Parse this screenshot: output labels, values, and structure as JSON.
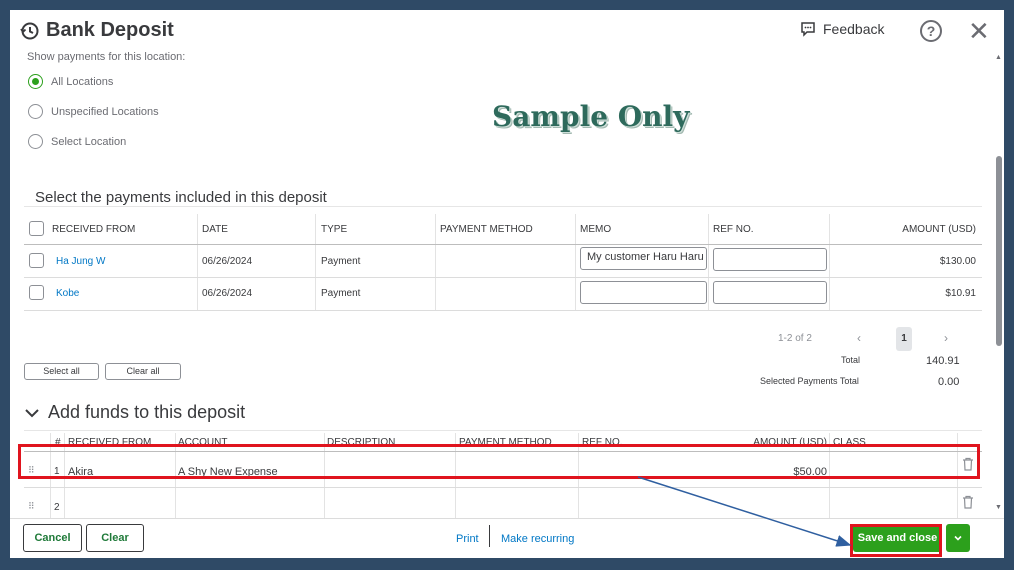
{
  "header": {
    "title": "Bank Deposit",
    "feedback_label": "Feedback",
    "help_label": "?",
    "close_label": "✕"
  },
  "location": {
    "label": "Show payments for this location:",
    "options": [
      {
        "label": "All Locations",
        "selected": true
      },
      {
        "label": "Unspecified Locations",
        "selected": false
      },
      {
        "label": "Select Location",
        "selected": false
      }
    ]
  },
  "watermark": "Sample Only",
  "payments": {
    "title": "Select the payments included in this deposit",
    "columns": [
      "RECEIVED FROM",
      "DATE",
      "TYPE",
      "PAYMENT METHOD",
      "MEMO",
      "REF NO.",
      "AMOUNT (USD)"
    ],
    "rows": [
      {
        "received_from": "Ha Jung W",
        "date": "06/26/2024",
        "type": "Payment",
        "payment_method": "",
        "memo": "My customer Haru Haru",
        "ref_no": "",
        "amount": "$130.00"
      },
      {
        "received_from": "Kobe",
        "date": "06/26/2024",
        "type": "Payment",
        "payment_method": "",
        "memo": "",
        "ref_no": "",
        "amount": "$10.91"
      }
    ],
    "pagination": {
      "range": "1-2 of 2",
      "prev": "‹",
      "page": "1",
      "next": "›"
    },
    "select_all_label": "Select all",
    "clear_all_label": "Clear all",
    "total_label": "Total",
    "total_value": "140.91",
    "selected_total_label": "Selected Payments Total",
    "selected_total_value": "0.00"
  },
  "funds": {
    "title": "Add funds to this deposit",
    "columns": [
      "#",
      "RECEIVED FROM",
      "ACCOUNT",
      "DESCRIPTION",
      "PAYMENT METHOD",
      "REF NO.",
      "AMOUNT (USD)",
      "CLASS"
    ],
    "rows": [
      {
        "num": "1",
        "received_from": "Akira",
        "account": "A Shy New Expense",
        "description": "",
        "payment_method": "",
        "ref_no": "",
        "amount": "$50.00",
        "class": ""
      },
      {
        "num": "2",
        "received_from": "",
        "account": "",
        "description": "",
        "payment_method": "",
        "ref_no": "",
        "amount": "",
        "class": ""
      }
    ]
  },
  "footer": {
    "cancel_label": "Cancel",
    "clear_label": "Clear",
    "print_label": "Print",
    "recurring_label": "Make recurring",
    "save_label": "Save and close",
    "dropdown_icon": "chevron-down-icon"
  },
  "colors": {
    "accent": "#2ca01c",
    "link": "#0077c5",
    "highlight": "#e0141e",
    "arrow": "#2f5fa0"
  }
}
